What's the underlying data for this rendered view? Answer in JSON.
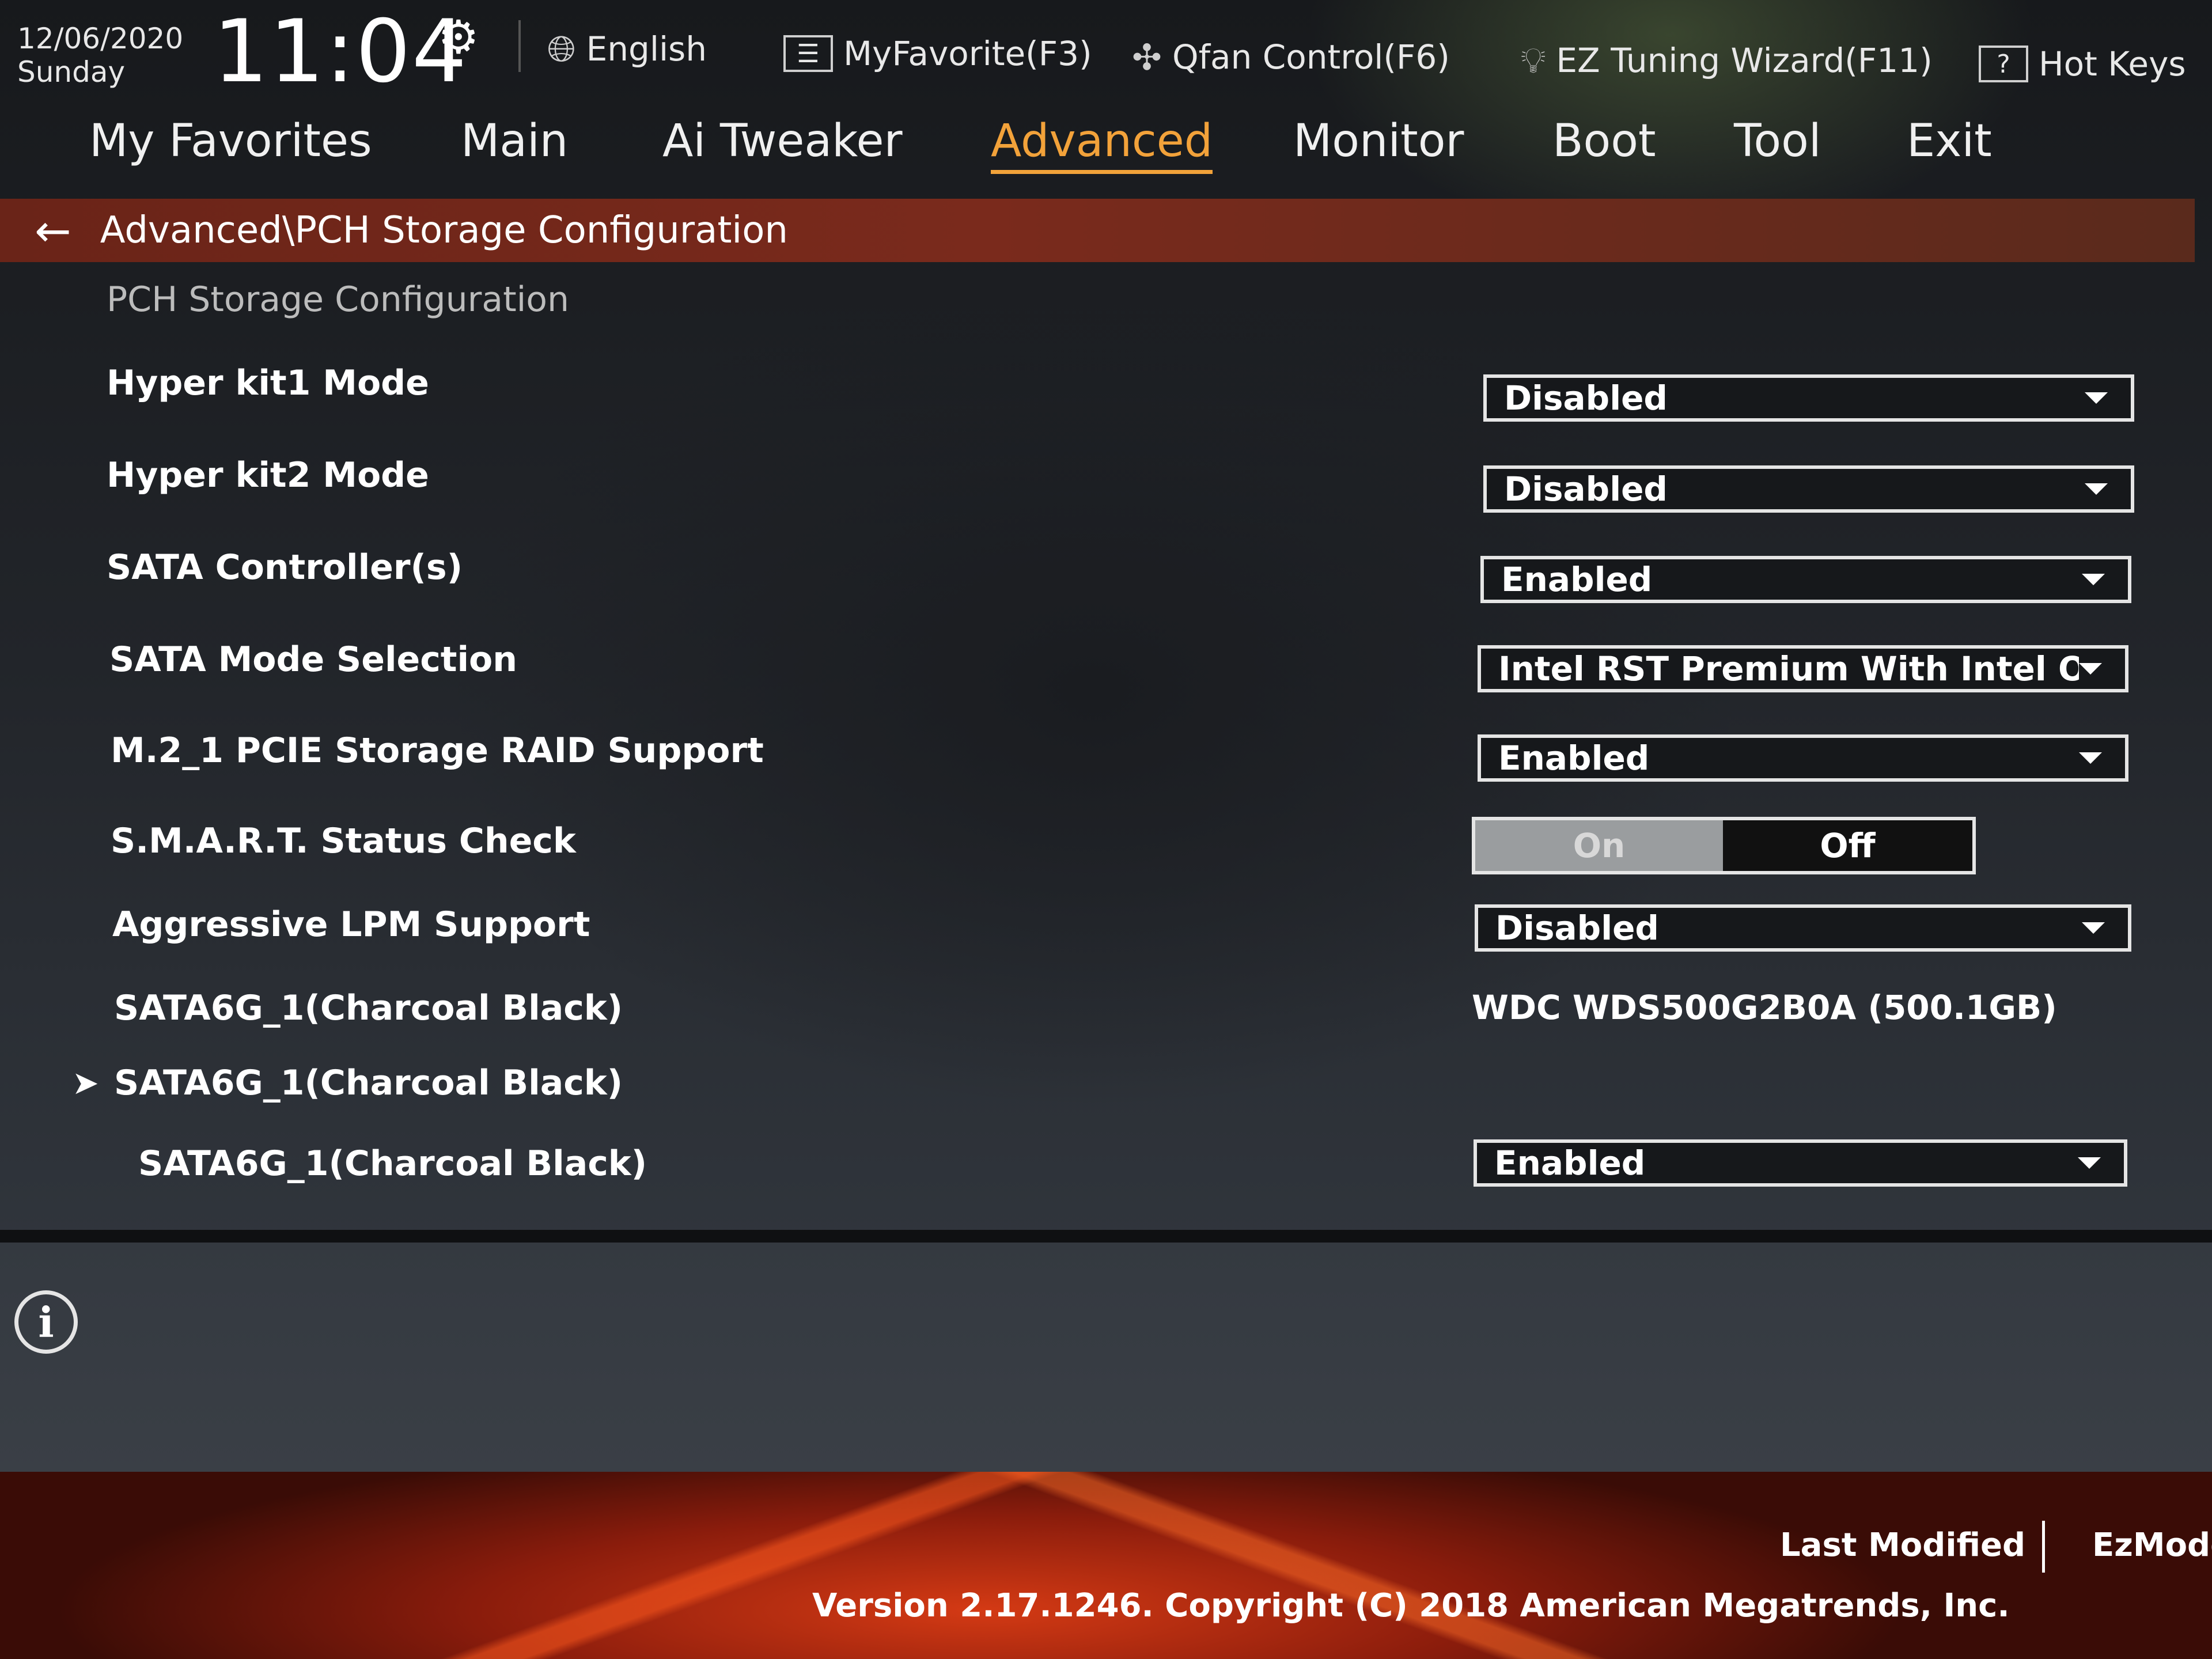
{
  "header": {
    "date": "12/06/2020",
    "day": "Sunday",
    "time": "11:04",
    "language": "English",
    "myfavorite": "MyFavorite(F3)",
    "qfan": "Qfan Control(F6)",
    "ez_tuning": "EZ Tuning Wizard(F11)",
    "hotkeys_box": "?",
    "hotkeys": "Hot Keys"
  },
  "nav": {
    "tabs": [
      {
        "label": "My Favorites"
      },
      {
        "label": "Main"
      },
      {
        "label": "Ai Tweaker"
      },
      {
        "label": "Advanced"
      },
      {
        "label": "Monitor"
      },
      {
        "label": "Boot"
      },
      {
        "label": "Tool"
      },
      {
        "label": "Exit"
      }
    ],
    "active": "Advanced"
  },
  "breadcrumb": {
    "path": "Advanced\\PCH Storage Configuration"
  },
  "content": {
    "section_title": "PCH Storage Configuration",
    "rows": [
      {
        "label": "Hyper kit1 Mode",
        "value": "Disabled"
      },
      {
        "label": "Hyper kit2 Mode",
        "value": "Disabled"
      },
      {
        "label": "SATA Controller(s)",
        "value": "Enabled"
      },
      {
        "label": "SATA Mode Selection",
        "value": "Intel RST Premium With Intel Op"
      },
      {
        "label": "M.2_1 PCIE Storage RAID Support",
        "value": "Enabled"
      },
      {
        "label": "S.M.A.R.T. Status Check",
        "on": "On",
        "off": "Off"
      },
      {
        "label": "Aggressive LPM Support",
        "value": "Disabled"
      },
      {
        "label": "SATA6G_1(Charcoal Black)",
        "value": "WDC WDS500G2B0A (500.1GB)"
      },
      {
        "label": "SATA6G_1(Charcoal Black)",
        "arrow": "➤"
      },
      {
        "label": "SATA6G_1(Charcoal Black)",
        "value": "Enabled"
      }
    ]
  },
  "footer": {
    "last_modified": "Last Modified",
    "ezmode": "EzMode",
    "version": "Version 2.17.1246. Copyright (C) 2018 American Megatrends, Inc."
  },
  "colors": {
    "accent": "#f2a23a",
    "breadcrumb_bg": "#7a2a1c",
    "footer_red": "#d43a14"
  }
}
